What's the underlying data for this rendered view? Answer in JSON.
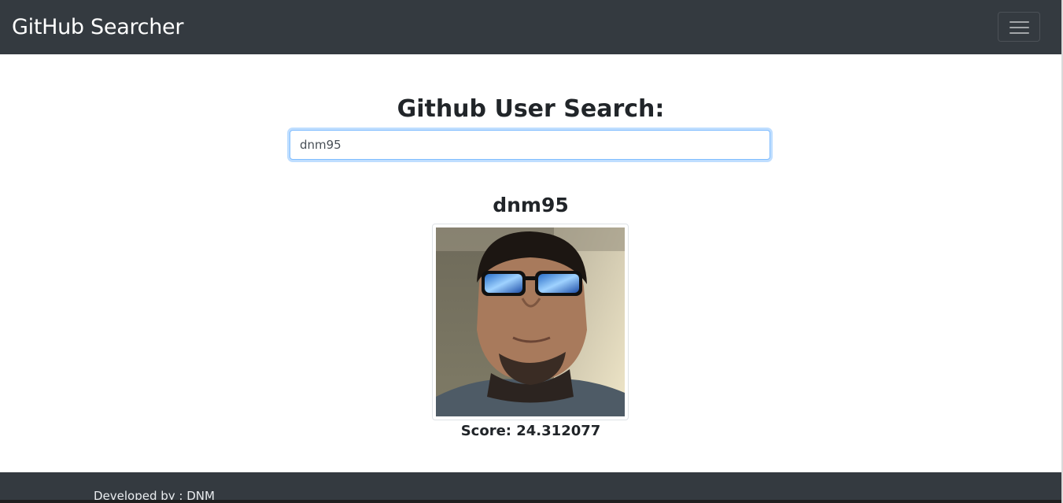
{
  "navbar": {
    "brand": "GitHub Searcher",
    "toggler_icon": "hamburger-menu-icon",
    "background": "#343a40"
  },
  "search": {
    "title": "Github User Search:",
    "value": "dnm95"
  },
  "result": {
    "username": "dnm95",
    "avatar_icon": "user-avatar-photo",
    "score_label": "Score: 24.312077"
  },
  "footer": {
    "text": "Developed by : DNM"
  },
  "colors": {
    "dark": "#343a40",
    "focus_border": "#80bdff",
    "text": "#212529"
  }
}
